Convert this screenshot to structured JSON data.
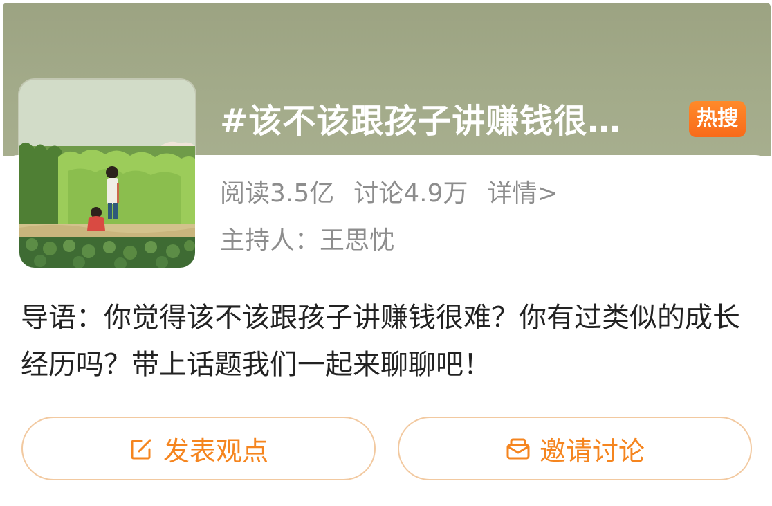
{
  "topic": {
    "title": "#该不该跟孩子讲赚钱很…",
    "badge": "热搜",
    "cover_image": "anime-illustration-child-in-field",
    "stats": {
      "read": "阅读3.5亿",
      "discuss": "讨论4.9万",
      "detail_link": "详情>"
    },
    "host": "主持人：王思忱",
    "intro": "导语：你觉得该不该跟孩子讲赚钱很难？你有过类似的成长经历吗？带上话题我们一起来聊聊吧！"
  },
  "actions": {
    "post_label": "发表观点",
    "post_icon": "edit-icon",
    "invite_label": "邀请讨论",
    "invite_icon": "mail-icon"
  },
  "colors": {
    "header_bg": "#a3ab8a",
    "badge_bg": "#f86a1a",
    "accent": "#f5851f",
    "button_border": "#f2c9a0",
    "meta_text": "#8d8d8d",
    "body_text": "#222222"
  }
}
